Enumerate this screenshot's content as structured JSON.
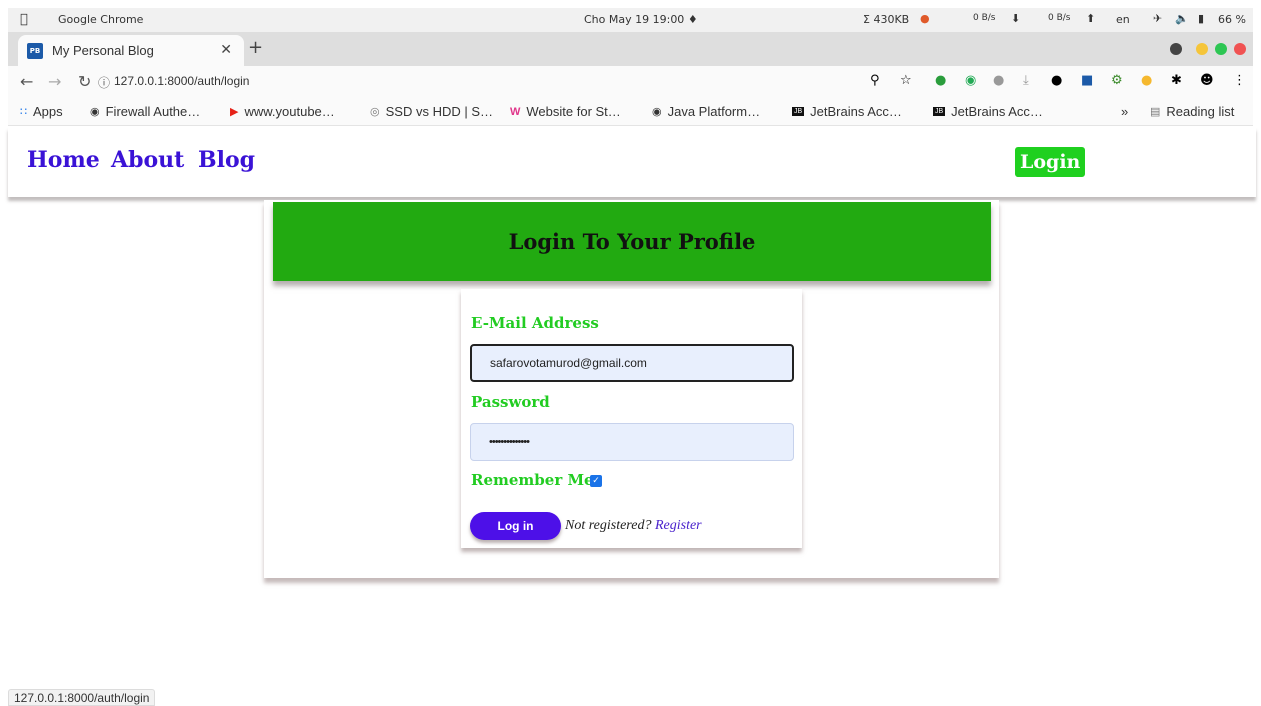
{
  "os": {
    "app_name": "Google Chrome",
    "datetime": "Cho May 19  19:00",
    "net_total": "Σ 430KB",
    "net_up": "0 B/s",
    "net_down": "0 B/s",
    "language": "en",
    "battery": "66 %"
  },
  "browser": {
    "tab_title": "My Personal Blog",
    "tab_favicon": "PB",
    "url": "127.0.0.1:8000/auth/login",
    "status_url": "127.0.0.1:8000/auth/login",
    "bookmarks": [
      {
        "label": "Apps",
        "icon": "apps-grid-icon"
      },
      {
        "label": "Firewall Authe…",
        "icon": "globe-icon"
      },
      {
        "label": "www.youtube…",
        "icon": "youtube-icon"
      },
      {
        "label": "SSD vs HDD | S…",
        "icon": "disk-icon"
      },
      {
        "label": "Website for St…",
        "icon": "w-logo-icon"
      },
      {
        "label": "Java Platform…",
        "icon": "globe-icon"
      },
      {
        "label": "JetBrains Acc…",
        "icon": "jetbrains-icon"
      },
      {
        "label": "JetBrains Acc…",
        "icon": "jetbrains-icon"
      }
    ],
    "reading_list": "Reading list"
  },
  "site_nav": {
    "home": "Home",
    "about": "About",
    "blog": "Blog",
    "login": "Login"
  },
  "login_form": {
    "heading": "Login To Your Profile",
    "email_label": "E-Mail Address",
    "email_value": "safarovotamurod@gmail.com",
    "password_label": "Password",
    "password_value": "••••••••••••••",
    "remember_label": "Remember Me",
    "remember_checked": true,
    "submit_label": "Log in",
    "not_registered": "Not registered?",
    "register_link": "Register"
  },
  "colors": {
    "nav_link": "#3a12d6",
    "accent_green": "#22aa11",
    "label_green": "#22cc22",
    "submit_purple": "#4d10e8"
  }
}
